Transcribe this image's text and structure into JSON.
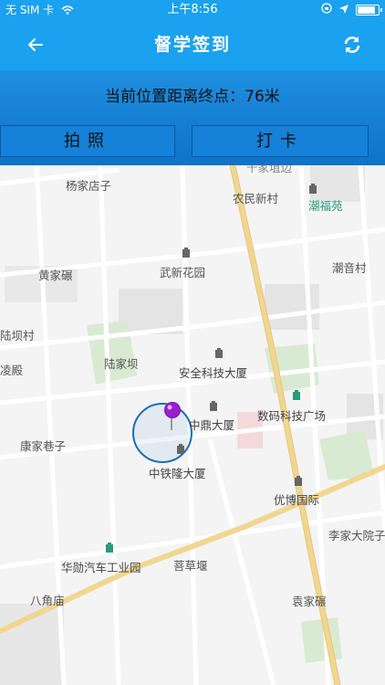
{
  "status_bar": {
    "carrier": "无 SIM 卡",
    "time": "上午8:56",
    "battery_level": 0.85,
    "icons": [
      "wifi-icon",
      "orientation-lock-icon",
      "location-arrow-icon",
      "battery-icon"
    ]
  },
  "nav": {
    "title": "督学签到",
    "back_icon": "arrow-left-icon",
    "refresh_icon": "refresh-icon"
  },
  "info": {
    "distance_text": "当前位置距离终点：76米"
  },
  "buttons": {
    "photo_label": "拍照",
    "checkin_label": "打卡"
  },
  "map": {
    "labels": {
      "yangjiadianzi": "杨家店子",
      "nongminxincun": "农民新村",
      "chaofuyuan": "潮福苑",
      "top_cut": "千家埴边",
      "huangjiawan": "黄家碾",
      "wuxinhuayuan": "武新花园",
      "chaoyincun": "潮音村",
      "lujiacun": "陆坝村",
      "lujiaba": "陆家坝",
      "lingdian": "凌殿",
      "anquan": "安全科技大厦",
      "shuma": "数码科技广场",
      "zhongding": "中鼎大厦",
      "kangjiaxiangzi": "康家巷子",
      "zhongtielong": "中铁隆大厦",
      "youbo": "优博国际",
      "lijiadayuanzi": "李家大院子",
      "huali": "华勋汽车工业园",
      "pucaoyan": "菩草堰",
      "bajiaomiao": "八角庙",
      "yuanjiawan": "袁家碾"
    },
    "poi_icon": "building-icon",
    "marker_icon": "map-pin-icon",
    "accuracy_circle": "location-accuracy-circle"
  }
}
